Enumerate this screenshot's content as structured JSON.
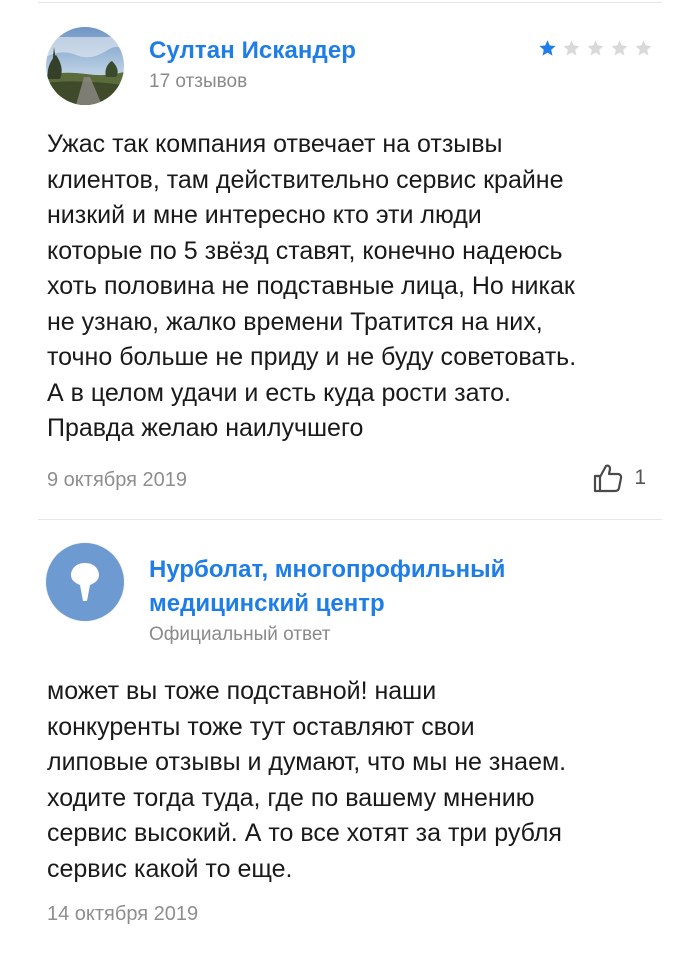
{
  "review": {
    "author": "Султан Искандер",
    "reviews_count": "17 отзывов",
    "rating": 1,
    "rating_max": 5,
    "text": "Ужас так компания отвечает на отзывы\nклиентов, там действительно сервис крайне\nнизкий и мне интересно кто эти люди\nкоторые по 5 звёзд ставят, конечно надеюсь\nхоть половина не подставные лица, Но никак\nне узнаю, жалко времени Тратится на них,\nточно больше не приду и не буду советовать.\nА в целом удачи и есть куда рости зато.\nПравда желаю наилучшего",
    "date": "9 октября 2019",
    "likes": "1"
  },
  "response": {
    "org_name": "Нурболат, многопрофильный медицинский центр",
    "label": "Официальный ответ",
    "text": "может вы тоже подставной! наши\nконкуренты тоже тут оставляют свои\nлиповые отзывы и думают, что мы не знаем.\nходите тогда туда, где по вашему мнению\nсервис высокий. А то все хотят за три рубля\nсервис какой то еще.",
    "date": "14 октября 2019"
  },
  "colors": {
    "link": "#1e7de6",
    "star_filled": "#1e7de6",
    "star_empty": "#d9d9d9",
    "muted": "#8e8e8e",
    "org_avatar_bg": "#6e9ad2"
  },
  "icons": {
    "like": "thumbs-up-icon",
    "org_avatar": "pin-logo-icon"
  }
}
